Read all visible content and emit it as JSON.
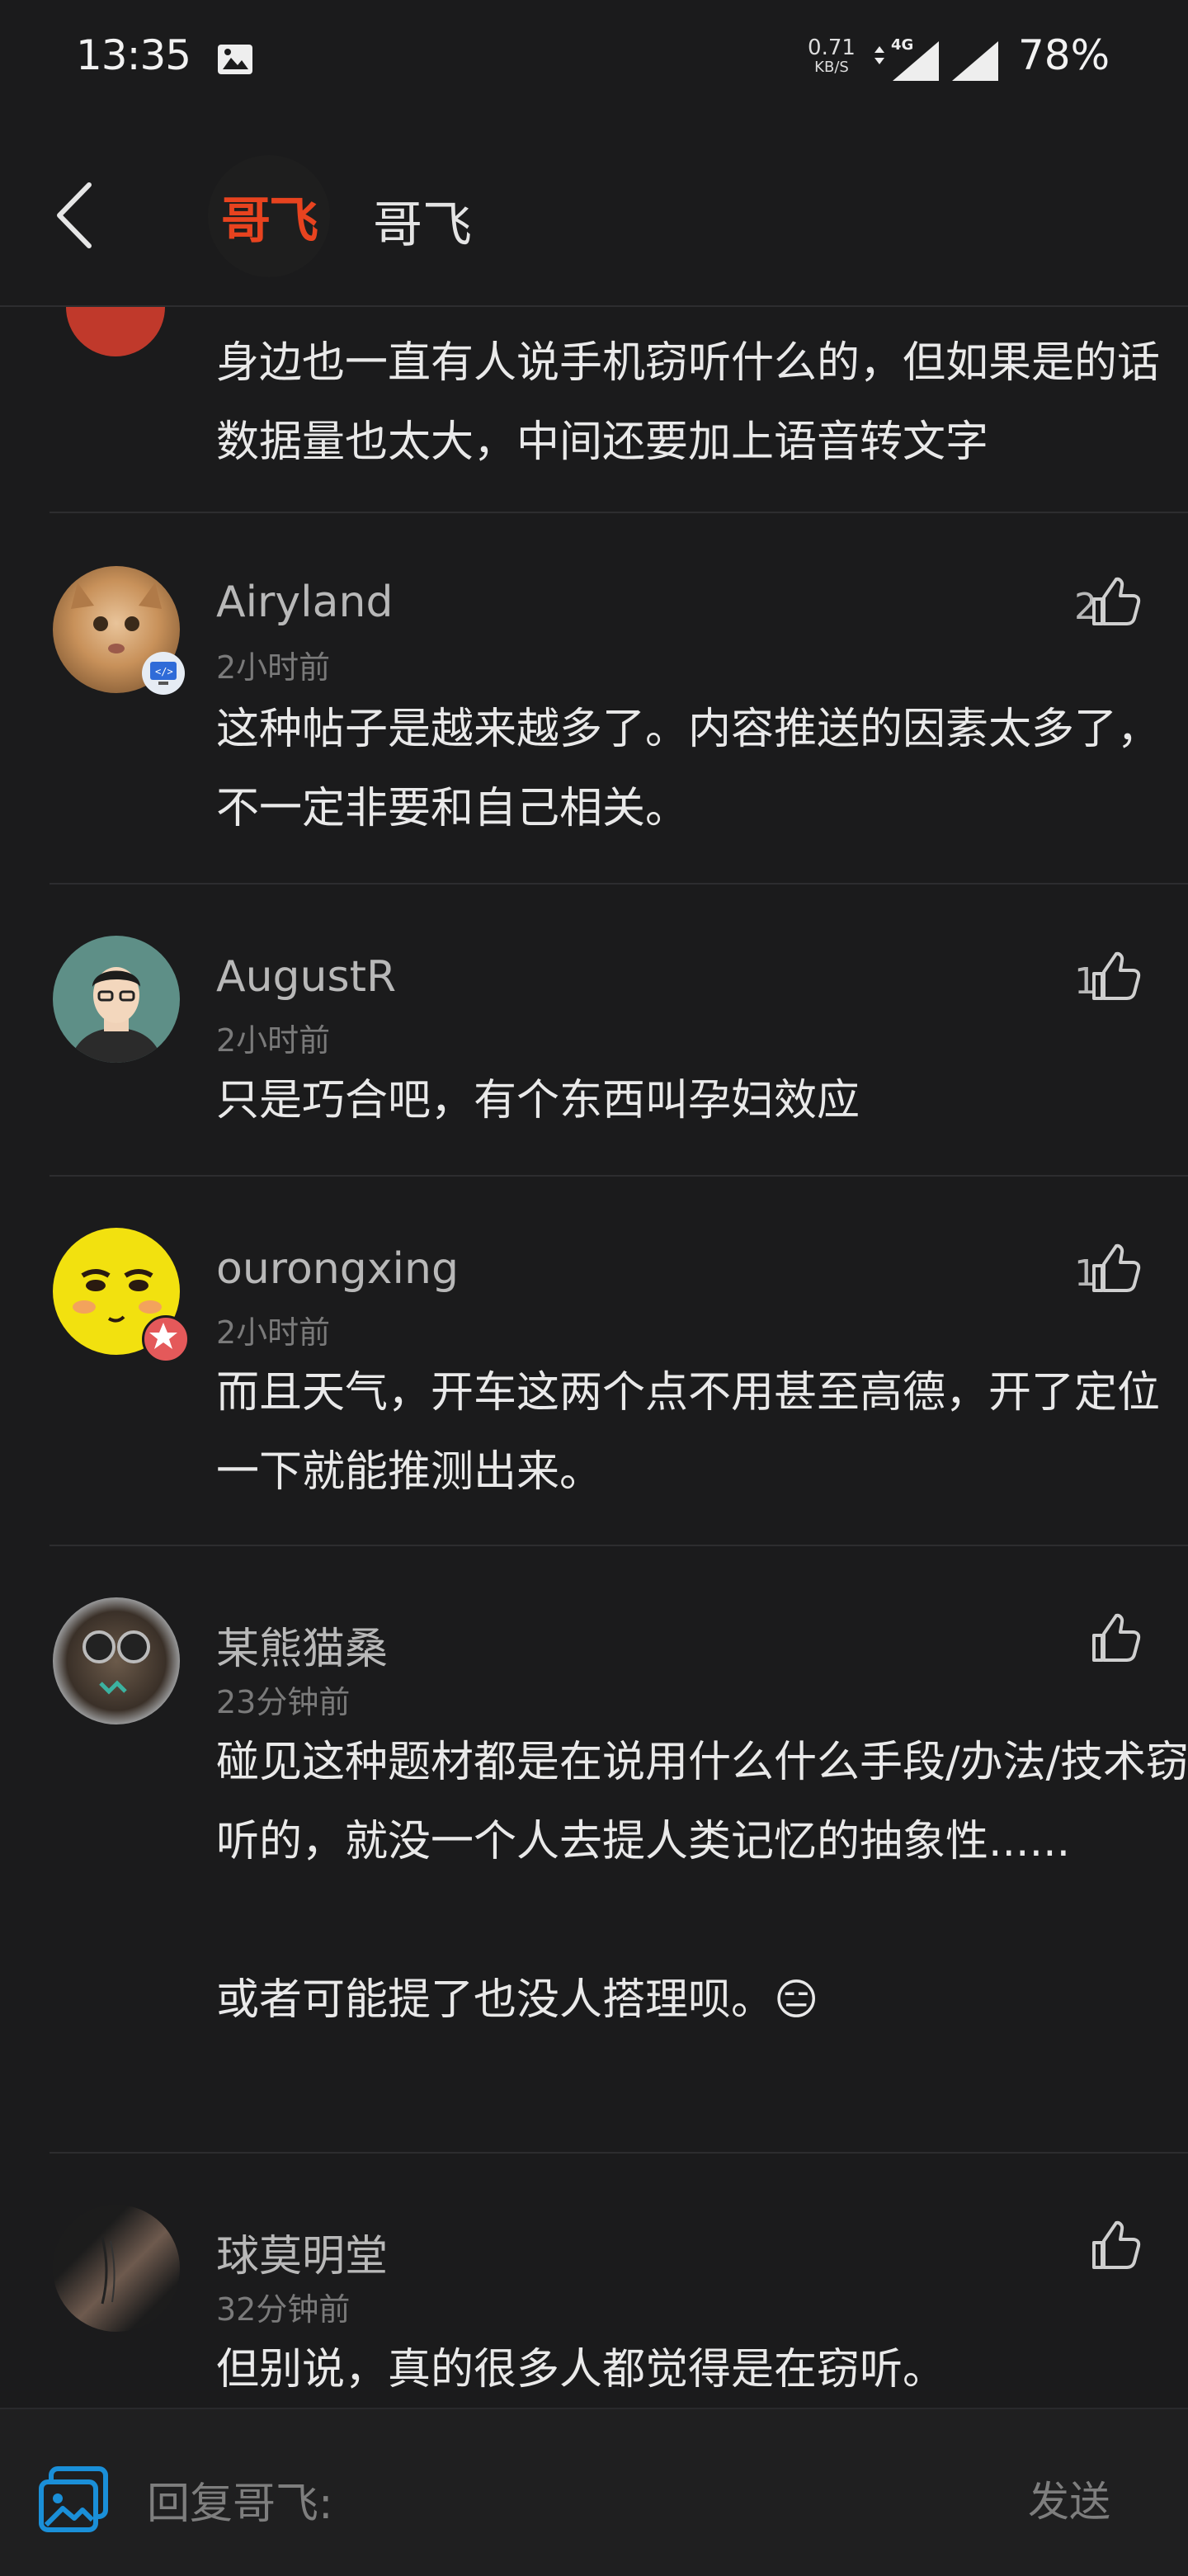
{
  "status_bar": {
    "time": "13:35",
    "net_speed": "0.71",
    "net_unit": "KB/S",
    "net_type": "4G",
    "battery": "78%"
  },
  "header": {
    "avatar_text": "哥飞",
    "title": "哥飞"
  },
  "partial_comment": {
    "body": "身边也一直有人说手机窃听什么的，但如果是的话数据量也太大，中间还要加上语音转文字"
  },
  "comments": [
    {
      "name": "Airyland",
      "time": "2小时前",
      "likes": "2",
      "body": "这种帖子是越来越多了。内容推送的因素太多了，不一定非要和自己相关。"
    },
    {
      "name": "AugustR",
      "time": "2小时前",
      "likes": "1",
      "body": "只是巧合吧，有个东西叫孕妇效应"
    },
    {
      "name": "ourongxing",
      "time": "2小时前",
      "likes": "1",
      "body": "而且天气，开车这两个点不用甚至高德，开了定位一下就能推测出来。"
    },
    {
      "name": "某熊猫桑",
      "time": "23分钟前",
      "likes": "",
      "body": "碰见这种题材都是在说用什么什么手段/办法/技术窃听的，就没一个人去提人类记忆的抽象性......\n\n或者可能提了也没人搭理呗。😑"
    },
    {
      "name": "球莫明堂",
      "time": "32分钟前",
      "likes": "",
      "body": "但别说，真的很多人都觉得是在窃听。"
    }
  ],
  "reply_bar": {
    "placeholder": "回复哥飞:",
    "send_label": "发送"
  },
  "colors": {
    "background": "#1b1b1c",
    "brand": "#e8431f",
    "accent": "#1a8fd8"
  }
}
